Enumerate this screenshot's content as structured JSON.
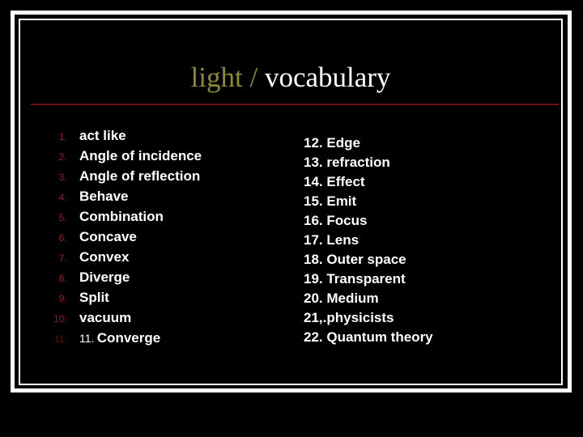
{
  "slide": {
    "title": {
      "part_olive": "light / ",
      "part_white": "vocabulary"
    },
    "colors": {
      "background": "#000000",
      "frame": "#ffffff",
      "title_olive": "#8C8C28",
      "title_white": "#ffffff",
      "rule_red": "#6E0F10",
      "marker_red": "#9B1C20",
      "marker_red_dim": "#5A1012",
      "body_text": "#ffffff"
    },
    "left_column": {
      "items": [
        {
          "number": "1.",
          "text": "act like"
        },
        {
          "number": "2.",
          "text": "Angle of incidence"
        },
        {
          "number": "3.",
          "text": "Angle of reflection"
        },
        {
          "number": "4.",
          "text": "Behave"
        },
        {
          "number": "5.",
          "text": "Combination"
        },
        {
          "number": "6.",
          "text": "Concave"
        },
        {
          "number": "7.",
          "text": "Convex"
        },
        {
          "number": "8.",
          "text": "Diverge"
        },
        {
          "number": "9.",
          "text": "Split"
        },
        {
          "number": "10.",
          "text": "vacuum"
        },
        {
          "number": "11.",
          "manual_number": "11.",
          "text": "Converge"
        }
      ]
    },
    "right_column": {
      "items": [
        "12. Edge",
        "13. refraction",
        "14. Effect",
        "15. Emit",
        "16. Focus",
        "17. Lens",
        "18. Outer space",
        "19. Transparent",
        "20. Medium",
        "21,.physicists",
        "22. Quantum theory"
      ]
    }
  }
}
